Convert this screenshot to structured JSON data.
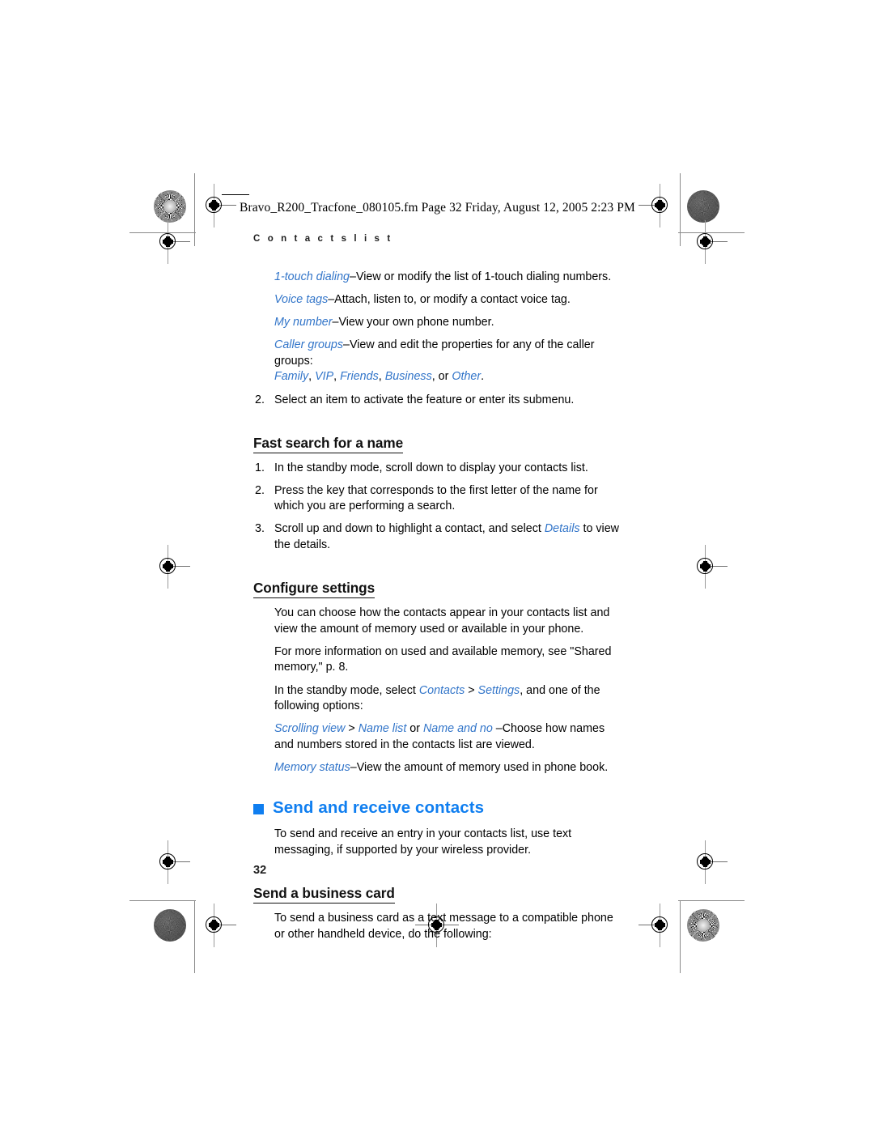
{
  "document": {
    "fm_banner": "Bravo_R200_Tracfone_080105.fm  Page 32  Friday, August 12, 2005  2:23 PM",
    "running_head": "C o n t a c t s   l i s t",
    "page_number": "32"
  },
  "colors": {
    "heading_blue": "#0f7ef0",
    "inline_blue": "#3275c9",
    "body_black": "#000000"
  },
  "content": {
    "menu_items": [
      {
        "term": "1-touch dialing",
        "rest": "–View or modify the list of 1-touch dialing numbers."
      },
      {
        "term": "Voice tags",
        "rest": "–Attach, listen to, or modify a contact voice tag."
      },
      {
        "term": "My number",
        "rest": "–View your own phone number."
      }
    ],
    "caller_groups": {
      "term": "Caller groups",
      "rest": "–View and edit the properties for any of the caller groups:",
      "groups": [
        "Family",
        "VIP",
        "Friends",
        "Business",
        "Other"
      ],
      "groups_line_sep_1": ", ",
      "groups_line_sep_2": ", or ",
      "groups_line_end": "."
    },
    "step_select_item": {
      "num": "2.",
      "text": "Select an item to activate the feature or enter its submenu."
    },
    "fast_search": {
      "heading": "Fast search for a name",
      "steps": [
        {
          "num": "1.",
          "text": "In the standby mode, scroll down to display your contacts list."
        },
        {
          "num": "2.",
          "text": "Press the key that corresponds to the first letter of the name for which you are performing a search."
        },
        {
          "num": "3.",
          "pre": "Scroll up and down to highlight a contact, and select ",
          "em": "Details",
          "post": " to view the details."
        }
      ]
    },
    "configure_settings": {
      "heading": "Configure settings",
      "p1": "You can choose how the contacts appear in your contacts list and view the amount of memory used or available in your phone.",
      "p2": "For more information on used and available memory, see \"Shared memory,\" p. 8.",
      "p3_pre": "In the standby mode, select ",
      "p3_em1": "Contacts",
      "p3_mid": " > ",
      "p3_em2": "Settings",
      "p3_post": ", and one of the following options:",
      "p4_em1": "Scrolling view",
      "p4_mid1": " > ",
      "p4_em2": "Name list",
      "p4_mid2": " or ",
      "p4_em3": "Name and no",
      "p4_post": " –Choose how names and numbers stored in the contacts list are viewed.",
      "p5_em": "Memory status",
      "p5_post": "–View the amount of memory used in phone book."
    },
    "send_receive": {
      "heading": "Send and receive contacts",
      "p1": "To send and receive an entry in your contacts list, use text messaging, if supported by your wireless provider."
    },
    "business_card": {
      "heading": "Send a business card",
      "p1": "To send a business card as a text message to a compatible phone or other handheld device, do the following:"
    }
  }
}
